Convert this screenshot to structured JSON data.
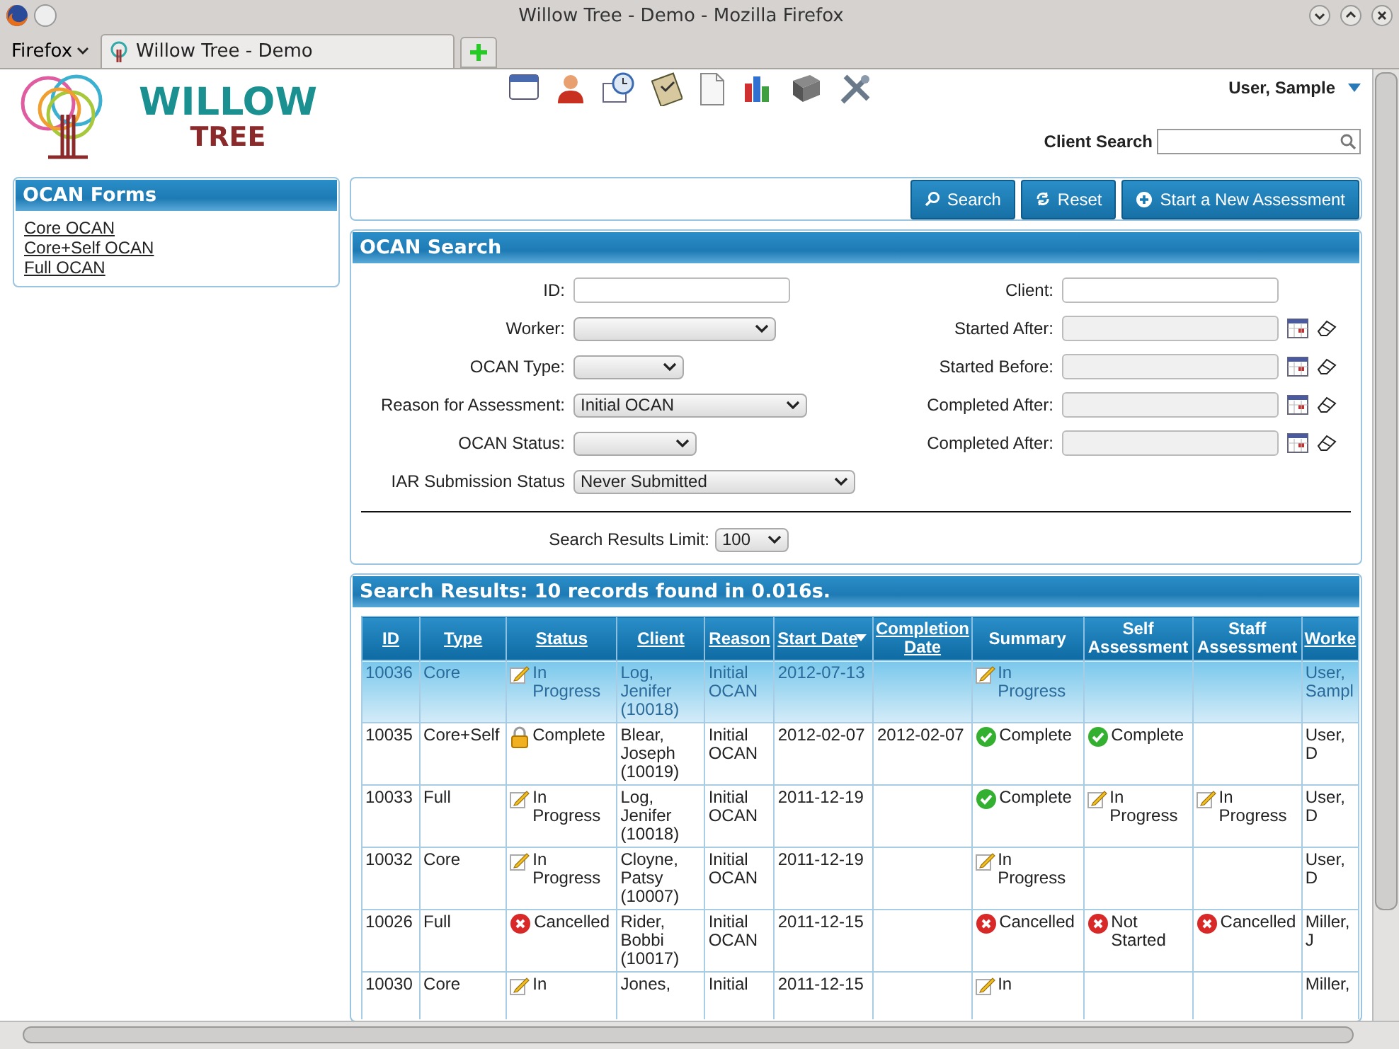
{
  "window": {
    "title": "Willow Tree - Demo - Mozilla Firefox"
  },
  "browser": {
    "menu": "Firefox",
    "tabs": [
      {
        "label": "Willow Tree - Demo",
        "selected": true
      }
    ]
  },
  "header": {
    "logo_top": "WILLOW",
    "logo_bottom": "TREE",
    "user": "User, Sample",
    "client_search": {
      "label": "Client Search"
    }
  },
  "sidebar": {
    "title": "OCAN Forms",
    "links": [
      "Core OCAN",
      "Core+Self OCAN",
      "Full OCAN"
    ]
  },
  "actions": [
    {
      "label": "Search",
      "kind": "search"
    },
    {
      "label": "Reset",
      "kind": "reset"
    },
    {
      "label": "Start a New Assessment",
      "kind": "add"
    }
  ],
  "search": {
    "title": "OCAN Search",
    "left_fields": [
      {
        "label": "ID:",
        "kind": "text"
      },
      {
        "label": "Worker:",
        "kind": "select"
      },
      {
        "label": "OCAN Type:",
        "kind": "select"
      },
      {
        "label": "Reason for Assessment:",
        "kind": "select",
        "value": "Initial OCAN"
      },
      {
        "label": "OCAN Status:",
        "kind": "select"
      },
      {
        "label": "IAR Submission Status",
        "kind": "select",
        "value": "Never Submitted"
      }
    ],
    "right_fields": [
      {
        "label": "Client:",
        "kind": "text"
      },
      {
        "label": "Started After:",
        "kind": "date"
      },
      {
        "label": "Started Before:",
        "kind": "date"
      },
      {
        "label": "Completed After:",
        "kind": "date"
      },
      {
        "label": "Completed After:",
        "kind": "date"
      }
    ],
    "limit": {
      "label": "Search Results Limit:",
      "value": "100"
    }
  },
  "results": {
    "title": "Search Results: 10 records found in 0.016s.",
    "columns": [
      {
        "label": "ID",
        "link": true,
        "sorted": false
      },
      {
        "label": "Type",
        "link": true,
        "sorted": false
      },
      {
        "label": "Status",
        "link": true,
        "sorted": false
      },
      {
        "label": "Client",
        "link": true,
        "sorted": false
      },
      {
        "label": "Reason",
        "link": true,
        "sorted": false
      },
      {
        "label": "Start Date",
        "link": true,
        "sorted": true
      },
      {
        "label": "Completion Date",
        "link": true,
        "sorted": false
      },
      {
        "label": "Summary",
        "link": false,
        "sorted": false
      },
      {
        "label": "Self Assessment",
        "link": false,
        "sorted": false
      },
      {
        "label": "Staff Assessment",
        "link": false,
        "sorted": false
      },
      {
        "label": "Worke",
        "link": true,
        "sorted": false
      }
    ],
    "rows": [
      {
        "selected": true,
        "id": "10036",
        "type": "Core",
        "status": {
          "kind": "in_progress",
          "text": "In Progress"
        },
        "client": "Log, Jenifer (10018)",
        "reason": "Initial OCAN",
        "start": "2012-07-13",
        "summary": {
          "kind": "in_progress",
          "text": "In Progress"
        },
        "worker": "User, Sampl"
      },
      {
        "selected": false,
        "id": "10035",
        "type": "Core+Self",
        "status": {
          "kind": "locked",
          "text": "Complete"
        },
        "client": "Blear, Joseph (10019)",
        "reason": "Initial OCAN",
        "start": "2012-02-07",
        "completion": "2012-02-07",
        "summary": {
          "kind": "complete",
          "text": "Complete"
        },
        "self": {
          "kind": "complete",
          "text": "Complete"
        },
        "worker": "User, D"
      },
      {
        "selected": false,
        "id": "10033",
        "type": "Full",
        "status": {
          "kind": "in_progress",
          "text": "In Progress"
        },
        "client": "Log, Jenifer (10018)",
        "reason": "Initial OCAN",
        "start": "2011-12-19",
        "summary": {
          "kind": "complete",
          "text": "Complete"
        },
        "self": {
          "kind": "in_progress",
          "text": "In Progress"
        },
        "staff": {
          "kind": "in_progress",
          "text": "In Progress"
        },
        "worker": "User, D"
      },
      {
        "selected": false,
        "id": "10032",
        "type": "Core",
        "status": {
          "kind": "in_progress",
          "text": "In Progress"
        },
        "client": "Cloyne, Patsy (10007)",
        "reason": "Initial OCAN",
        "start": "2011-12-19",
        "summary": {
          "kind": "in_progress",
          "text": "In Progress"
        },
        "worker": "User, D"
      },
      {
        "selected": false,
        "id": "10026",
        "type": "Full",
        "status": {
          "kind": "cancelled",
          "text": "Cancelled"
        },
        "client": "Rider, Bobbi (10017)",
        "reason": "Initial OCAN",
        "start": "2011-12-15",
        "summary": {
          "kind": "cancelled",
          "text": "Cancelled"
        },
        "self": {
          "kind": "cancelled",
          "text": "Not Started"
        },
        "staff": {
          "kind": "cancelled",
          "text": "Cancelled"
        },
        "worker": "Miller, J"
      },
      {
        "selected": false,
        "id": "10030",
        "type": "Core",
        "status": {
          "kind": "in_progress",
          "text": "In"
        },
        "client": "Jones,",
        "reason": "Initial",
        "start": "2011-12-15",
        "summary": {
          "kind": "in_progress",
          "text": "In"
        },
        "worker": "Miller,"
      }
    ]
  }
}
